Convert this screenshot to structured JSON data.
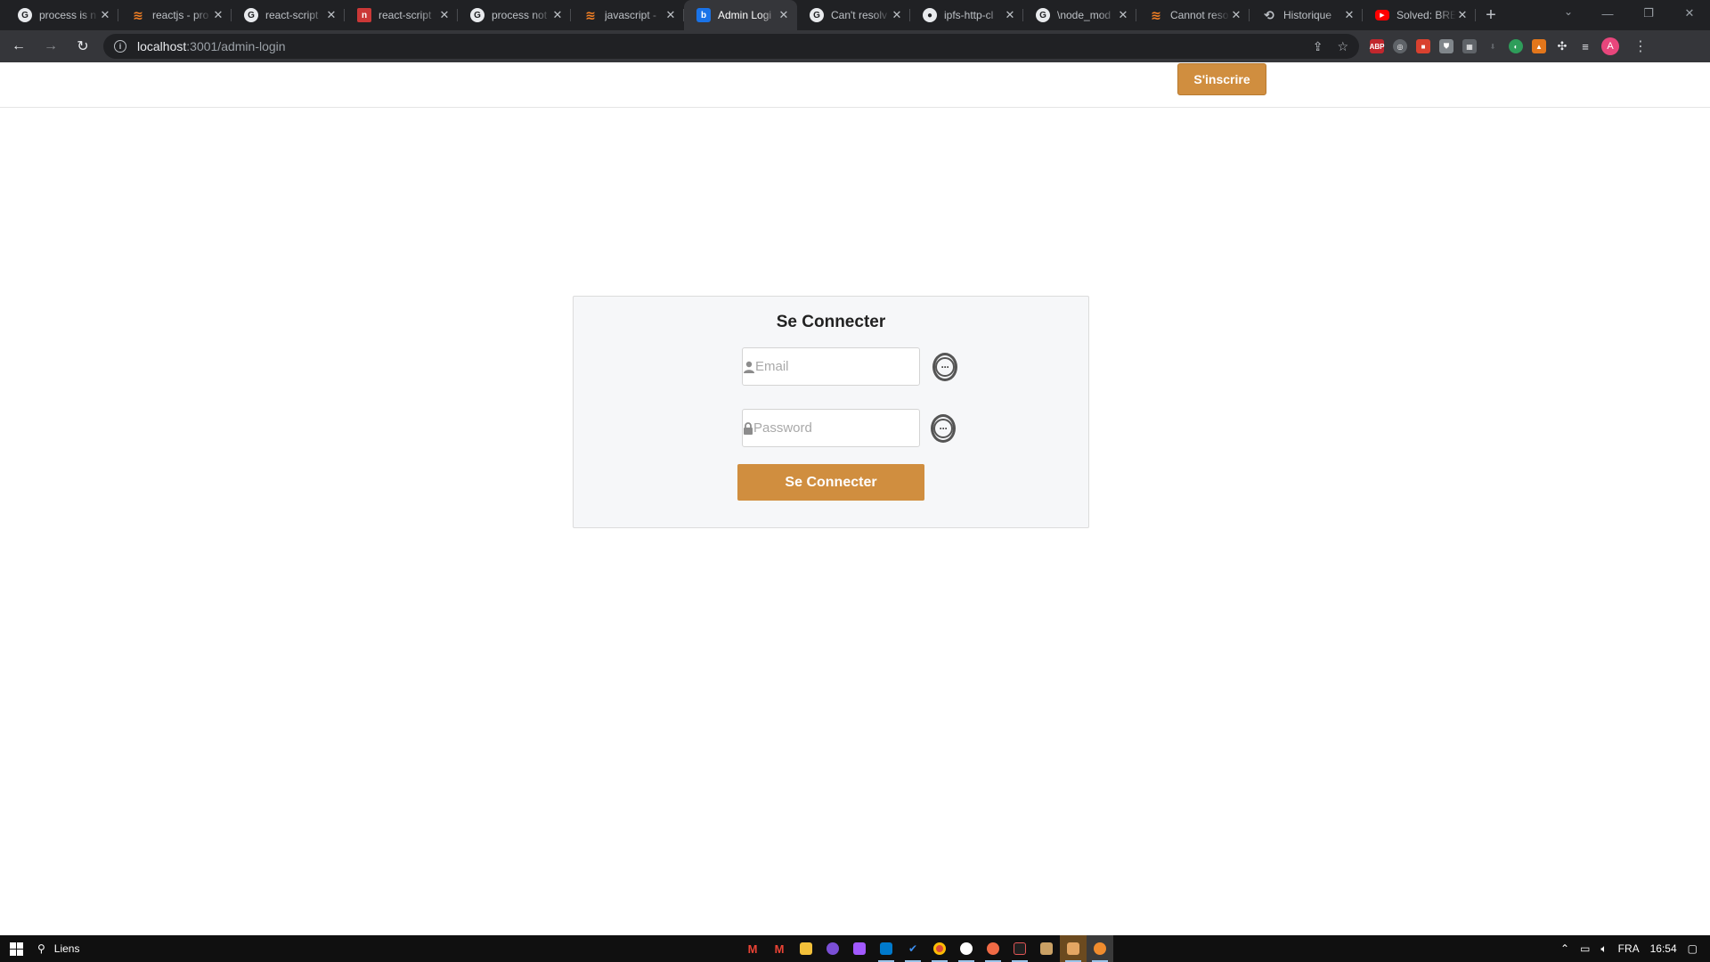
{
  "browser": {
    "tabs": [
      {
        "title": "process is n",
        "favicon": "google-icon"
      },
      {
        "title": "reactjs - pro",
        "favicon": "stackoverflow-icon"
      },
      {
        "title": "react-script",
        "favicon": "google-icon"
      },
      {
        "title": "react-script",
        "favicon": "npm-icon"
      },
      {
        "title": "process not",
        "favicon": "google-icon"
      },
      {
        "title": "javascript -",
        "favicon": "stackoverflow-icon"
      },
      {
        "title": "Admin Logi",
        "favicon": "bootstrap-icon",
        "active": true
      },
      {
        "title": "Can't resolv",
        "favicon": "google-icon"
      },
      {
        "title": "ipfs-http-cl",
        "favicon": "github-icon"
      },
      {
        "title": "\\node_mod",
        "favicon": "google-icon"
      },
      {
        "title": "Cannot reso",
        "favicon": "stackoverflow-icon"
      },
      {
        "title": "Historique",
        "favicon": "history-icon"
      },
      {
        "title": "Solved: BRE",
        "favicon": "youtube-icon"
      }
    ],
    "url_host": "localhost",
    "url_path": ":3001/admin-login",
    "profile_initial": "A"
  },
  "page": {
    "signup_label": "S'inscrire",
    "login": {
      "title": "Se Connecter",
      "email_placeholder": "Email",
      "password_placeholder": "Password",
      "submit_label": "Se Connecter"
    }
  },
  "taskbar": {
    "search_label": "Liens",
    "language": "FRA",
    "time": "16:54"
  },
  "colors": {
    "accent": "#d08e3f",
    "card_bg": "#f6f7f9",
    "chrome_dark": "#202124",
    "chrome_toolbar": "#35363a"
  }
}
